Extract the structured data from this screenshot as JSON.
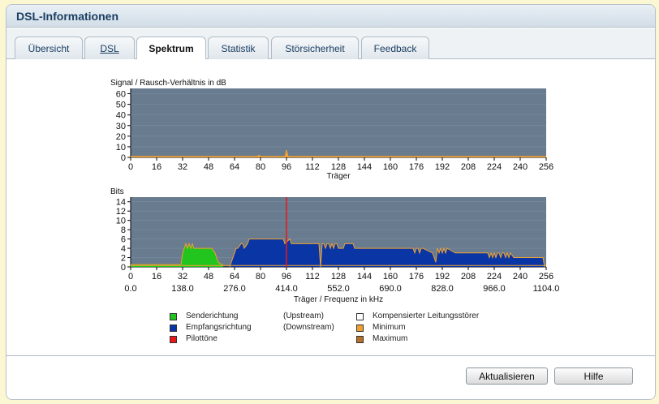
{
  "window": {
    "title": "DSL-Informationen"
  },
  "tabs": [
    {
      "label": "Übersicht"
    },
    {
      "label": "DSL"
    },
    {
      "label": "Spektrum"
    },
    {
      "label": "Statistik"
    },
    {
      "label": "Störsicherheit"
    },
    {
      "label": "Feedback"
    }
  ],
  "colors": {
    "plot_bg": "#687b8f",
    "upstream": "#22c51e",
    "downstream": "#0a35a4",
    "pilot": "#e81818",
    "minimum": "#f0a030",
    "maximum": "#b87028",
    "grid": "#7d8ea0"
  },
  "chart_data": [
    {
      "type": "area",
      "title": "Signal / Rausch-Verhältnis in dB",
      "xlabel": "Träger",
      "ylim": [
        0,
        65
      ],
      "xlim": [
        0,
        256
      ],
      "yticks": [
        "60",
        "50",
        "40",
        "30",
        "20",
        "10",
        "0"
      ],
      "xticks": [
        "0",
        "16",
        "32",
        "48",
        "64",
        "80",
        "96",
        "112",
        "128",
        "144",
        "160",
        "176",
        "192",
        "208",
        "224",
        "240",
        "256"
      ],
      "series": [
        {
          "x": [
            0,
            78,
            79,
            80,
            81,
            95,
            96,
            97,
            256
          ],
          "values": [
            1,
            1,
            2,
            1,
            1,
            1,
            7,
            1,
            1
          ]
        }
      ]
    },
    {
      "type": "area",
      "title": "Bits",
      "xlabel": "Träger / Frequenz in kHz",
      "ylim": [
        0,
        15
      ],
      "xlim": [
        0,
        256
      ],
      "yticks": [
        "14",
        "12",
        "10",
        "8",
        "6",
        "4",
        "2",
        "0"
      ],
      "xticks": [
        "0",
        "16",
        "32",
        "48",
        "64",
        "80",
        "96",
        "112",
        "128",
        "144",
        "160",
        "176",
        "192",
        "208",
        "224",
        "240",
        "256"
      ],
      "freq_ticks": [
        "0.0",
        "138.0",
        "276.0",
        "414.0",
        "552.0",
        "690.0",
        "828.0",
        "966.0",
        "1104.0"
      ],
      "pilot_tone_carrier": 96,
      "series": [
        {
          "name": "Senderichtung",
          "x": [
            0,
            31,
            32,
            33,
            34,
            35,
            36,
            37,
            38,
            39,
            40,
            41,
            50,
            52,
            54,
            56,
            57
          ],
          "values": [
            0.5,
            0.5,
            3,
            4,
            5,
            4,
            5,
            4,
            5,
            4,
            4,
            4,
            4,
            3,
            1,
            0.5,
            0.5
          ]
        },
        {
          "name": "Empfangsrichtung",
          "x": [
            61,
            62,
            63,
            64,
            65,
            66,
            68,
            69,
            70,
            72,
            73,
            75,
            94,
            95,
            98,
            99,
            116,
            117,
            118,
            119,
            120,
            121,
            122,
            123,
            124,
            125,
            126,
            127,
            128,
            131,
            132,
            137,
            138,
            174,
            175,
            176,
            177,
            178,
            179,
            180,
            186,
            187,
            188,
            189,
            190,
            191,
            192,
            193,
            194,
            195,
            200,
            220,
            221,
            222,
            223,
            224,
            225,
            226,
            227,
            228,
            229,
            230,
            231,
            232,
            233,
            234,
            236,
            254,
            255
          ],
          "values": [
            0,
            1,
            2,
            3,
            4,
            4,
            5,
            5,
            4,
            5,
            6,
            6,
            6,
            5,
            6,
            5,
            5,
            0,
            5,
            5,
            4,
            5,
            5,
            4,
            5,
            4,
            5,
            5,
            4,
            4,
            5,
            5,
            4,
            4,
            3,
            4,
            4,
            3,
            4,
            4,
            3,
            2,
            1,
            4,
            3,
            4,
            3,
            4,
            3,
            4,
            3,
            3,
            2,
            3,
            2,
            3,
            2,
            3,
            3,
            2,
            3,
            3,
            2,
            3,
            2,
            3,
            2,
            2,
            0
          ]
        }
      ]
    }
  ],
  "legend": {
    "upstream": "Senderichtung",
    "upstream_note": "(Upstream)",
    "downstream": "Empfangsrichtung",
    "downstream_note": "(Downstream)",
    "pilot": "Pilottöne",
    "compensated": "Kompensierter Leitungsstörer",
    "minimum": "Minimum",
    "maximum": "Maximum"
  },
  "buttons": {
    "refresh": "Aktualisieren",
    "help": "Hilfe"
  }
}
